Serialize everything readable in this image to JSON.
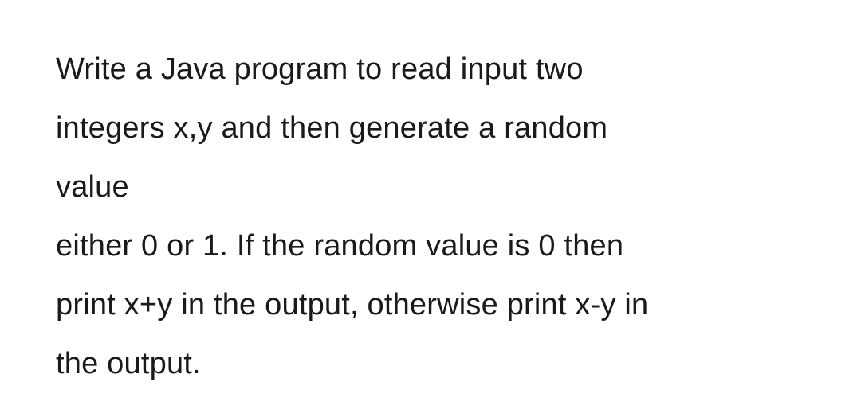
{
  "problem": {
    "line1": "Write a Java program to read input two",
    "line2": "integers x,y and then generate a random",
    "line3": "value",
    "line4": "either 0 or 1. If the random value is 0 then",
    "line5": "print x+y in the output, otherwise print x-y in",
    "line6": "the output."
  }
}
